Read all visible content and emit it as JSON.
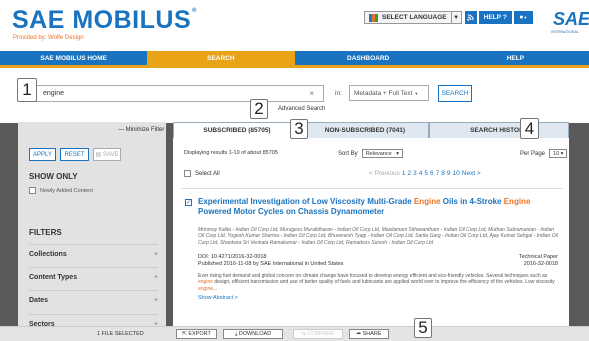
{
  "header": {
    "logo_text": "SAE MOBILUS",
    "logo_mark": "®",
    "provided_by": "Provided by: Wolfe Design",
    "language_label": "SELECT LANGUAGE",
    "help_label": "HELP",
    "sae_logo": "SAE",
    "sae_sub": "INTERNATIONAL"
  },
  "nav": {
    "items": [
      "SAE MOBILUS HOME",
      "SEARCH",
      "DASHBOARD",
      "HELP"
    ],
    "active": "SEARCH"
  },
  "search": {
    "value": "engine",
    "clear": "×",
    "in_label": "in:",
    "scope": "Metadata + Full Text",
    "button": "SEARCH",
    "advanced": "Advanced Search"
  },
  "callouts": [
    "1",
    "2",
    "3",
    "4",
    "5"
  ],
  "sidebar": {
    "minimize": "— Minimize Filter",
    "apply": "APPLY",
    "reset": "RESET",
    "save": "SAVE",
    "show_only": "SHOW ONLY",
    "newly_added": "Newly Added Content",
    "filters": "FILTERS",
    "facets": [
      "Collections",
      "Content Types",
      "Dates",
      "Sectors"
    ]
  },
  "tabs": {
    "subscribed": "SUBSCRIBED (85705)",
    "non_subscribed": "NON-SUBSCRIBED (7041)",
    "history": "SEARCH HISTORY"
  },
  "results": {
    "displaying": "Displaying results 1-10 of about 85705",
    "sort_label": "Sort By",
    "sort_value": "Relevance",
    "per_page_label": "Per Page",
    "per_page_value": "10",
    "select_all": "Select All",
    "prev": "< Previous",
    "pages": [
      "1",
      "2",
      "3",
      "4",
      "5",
      "6",
      "7",
      "8",
      "9",
      "10"
    ],
    "next": "Next >"
  },
  "result1": {
    "title_a": "Experimental Investigation of Low Viscosity Multi-Grade ",
    "title_hl1": "Engine",
    "title_b": " Oils in 4-Stroke ",
    "title_hl2": "Engine",
    "title_c": " Powered Motor Cycles on Chassis Dynamometer",
    "authors": "Mrinmoy Kalita - Indian Oil Corp Ltd, Murugesu Muralidharan - Indian Oil Corp Ltd, Masilamani Sithanantham - Indian Oil Corp Ltd, Muthan Subramanian - Indian Oil Corp Ltd, Yogesh Kumar Sharma - Indian Oil Corp Ltd, Bhuvenesh Tyagi - Indian Oil Corp Ltd, Sarita Garg - Indian Oil Corp Ltd, Ajay Kumar Sehgal - Indian Oil Corp Ltd, Shankara Sri Venkata Ramakumar - Indian Oil Corp Ltd, Ramadoss Suresh - Indian Oil Corp Ltd",
    "doi": "DOI: 10.4271/2016-32-0018",
    "published": "Published 2016-11-08 by SAE International in United States",
    "type": "Technical Paper",
    "number": "2016-32-0018",
    "abstract_a": "Ever rising fuel demand and global concern on climate change have focused to develop energy efficient and eco-friendly vehicles. Several techniques such as ",
    "abstract_hl1": "engine",
    "abstract_b": " design, efficient transmission and use of better quality of fuels and lubricants are applied world over to improve the efficiency of the vehicles. Low viscosity ",
    "abstract_hl2": "engine",
    "abstract_c": "...",
    "show_abstract": "Show Abstract >"
  },
  "bottom": {
    "file_selected": "1 FILE SELECTED",
    "export": "EXPORT",
    "download": "DOWNLOAD",
    "disabled_btn": "COMPARE",
    "share": "SHARE"
  },
  "colors": {
    "brand_blue": "#1a73c0",
    "accent_orange": "#e8a317",
    "highlight": "#e8742a"
  }
}
